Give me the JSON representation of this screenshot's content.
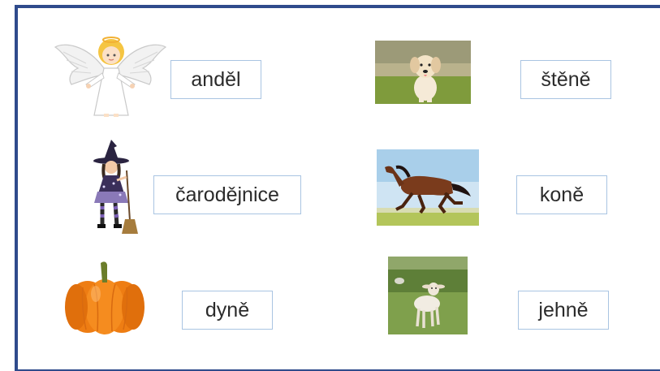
{
  "slide": {
    "border_color": "#2f4b8c",
    "label_border_color": "#a9c4e2",
    "cards": [
      {
        "word": "anděl",
        "picture": "angel"
      },
      {
        "word": "čarodějnice",
        "picture": "witch"
      },
      {
        "word": "dyně",
        "picture": "pumpkin"
      },
      {
        "word": "štěně",
        "picture": "puppy"
      },
      {
        "word": "koně",
        "picture": "horse"
      },
      {
        "word": "jehně",
        "picture": "lamb"
      }
    ]
  }
}
